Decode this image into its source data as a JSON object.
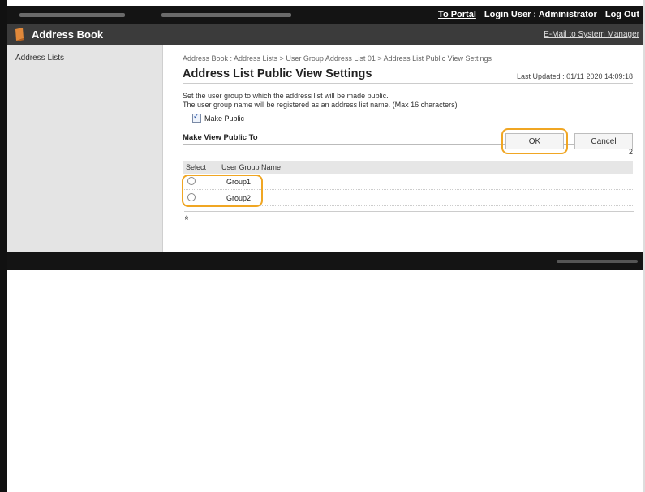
{
  "topbar": {
    "to_portal": "To Portal",
    "login_user": "Login User : Administrator",
    "logout": "Log Out"
  },
  "header": {
    "title": "Address Book",
    "email_link": "E-Mail to System Manager"
  },
  "sidebar": {
    "items": [
      {
        "label": "Address Lists"
      }
    ]
  },
  "main": {
    "breadcrumb": "Address Book : Address Lists > User Group Address List 01 > Address List Public View Settings",
    "title": "Address List Public View Settings",
    "last_updated": "Last Updated : 01/11 2020 14:09:18",
    "desc_line1": "Set the user group to which the address list will be made public.",
    "desc_line2": "The user group name will be registered as an address list name. (Max 16 characters)",
    "ok_label": "OK",
    "cancel_label": "Cancel",
    "make_public_label": "Make Public",
    "make_public_checked": true,
    "section_title": "Make View Public To",
    "count": "2",
    "table": {
      "headers": [
        "Select",
        "User Group Name"
      ],
      "rows": [
        {
          "name": "Group1",
          "selected": false
        },
        {
          "name": "Group2",
          "selected": false
        }
      ]
    },
    "collapse_icon": "collapse-icon"
  },
  "colors": {
    "highlight": "#f0a623",
    "topbar": "#141414",
    "titlebar": "#3b3b3b"
  }
}
